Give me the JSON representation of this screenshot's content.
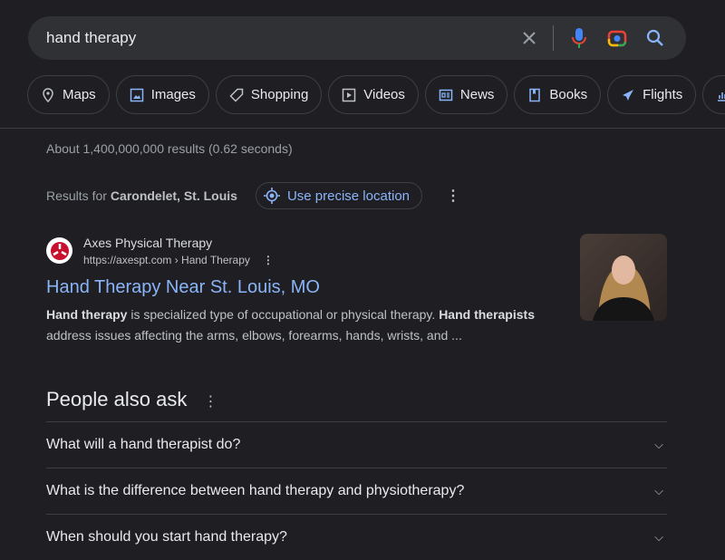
{
  "search": {
    "query": "hand therapy"
  },
  "chips": [
    {
      "label": "Maps",
      "icon": "map-pin-icon"
    },
    {
      "label": "Images",
      "icon": "image-icon"
    },
    {
      "label": "Shopping",
      "icon": "tag-icon"
    },
    {
      "label": "Videos",
      "icon": "video-icon"
    },
    {
      "label": "News",
      "icon": "news-icon"
    },
    {
      "label": "Books",
      "icon": "book-icon"
    },
    {
      "label": "Flights",
      "icon": "plane-icon"
    }
  ],
  "stats": "About 1,400,000,000 results (0.62 seconds)",
  "location": {
    "prefix": "Results for",
    "place": "Carondelet, St. Louis",
    "button": "Use precise location"
  },
  "result": {
    "site": "Axes Physical Therapy",
    "url": "https://axespt.com › Hand Therapy",
    "title": "Hand Therapy Near St. Louis, MO",
    "snippet_b1": "Hand therapy",
    "snippet_t1": " is specialized type of occupational or physical therapy. ",
    "snippet_b2": "Hand therapists",
    "snippet_t2": " address issues affecting the arms, elbows, forearms, hands, wrists, and ..."
  },
  "paa": {
    "heading": "People also ask",
    "questions": [
      "What will a hand therapist do?",
      "What is the difference between hand therapy and physiotherapy?",
      "When should you start hand therapy?"
    ]
  },
  "colors": {
    "link": "#8ab4f8",
    "background": "#1f1f23"
  }
}
